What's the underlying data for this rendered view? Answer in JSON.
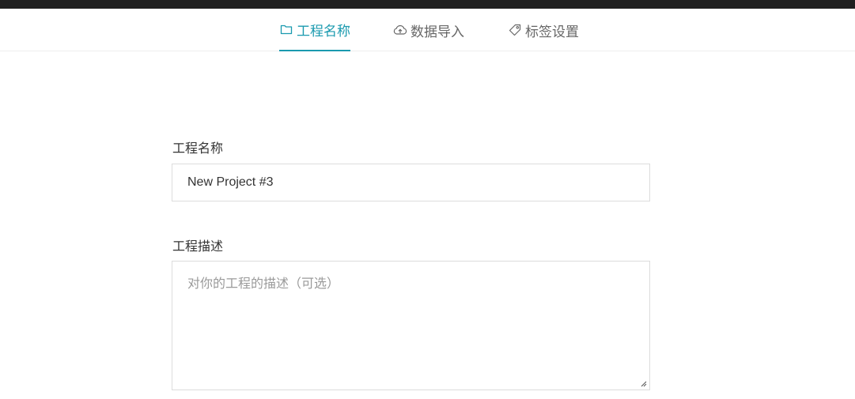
{
  "tabs": [
    {
      "label": "工程名称",
      "icon": "folder-icon",
      "active": true
    },
    {
      "label": "数据导入",
      "icon": "cloud-upload-icon",
      "active": false
    },
    {
      "label": "标签设置",
      "icon": "tag-icon",
      "active": false
    }
  ],
  "form": {
    "name_label": "工程名称",
    "name_value": "New Project #3",
    "desc_label": "工程描述",
    "desc_placeholder": "对你的工程的描述（可选）"
  },
  "colors": {
    "accent": "#1a9aaf",
    "top_bar": "#1f1f1f",
    "border": "#dcdcdc"
  }
}
